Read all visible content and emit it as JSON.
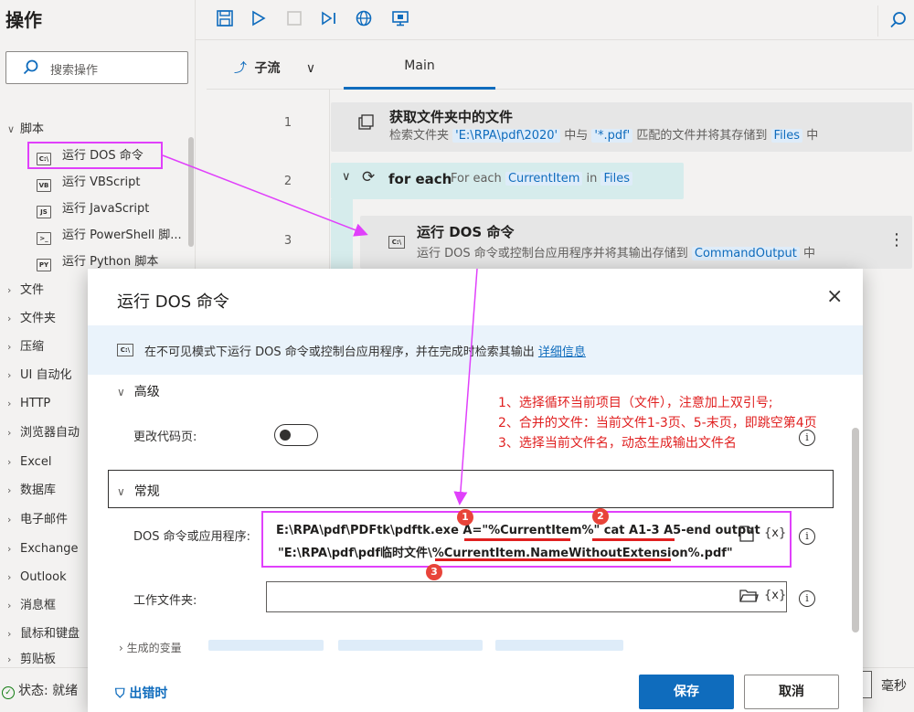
{
  "sidebar": {
    "title": "操作",
    "search_placeholder": "搜索操作",
    "scripts_group": "脚本",
    "script_items": [
      {
        "icon": "C:\\",
        "label": "运行 DOS 命令"
      },
      {
        "icon": "VB",
        "label": "运行 VBScript"
      },
      {
        "icon": "JS",
        "label": "运行 JavaScript"
      },
      {
        "icon": ">_",
        "label": "运行 PowerShell 脚..."
      },
      {
        "icon": "PY",
        "label": "运行 Python 脚本"
      }
    ],
    "groups": [
      "文件",
      "文件夹",
      "压缩",
      "UI 自动化",
      "HTTP",
      "浏览器自动",
      "Excel",
      "数据库",
      "电子邮件",
      "Exchange",
      "Outlook",
      "消息框",
      "鼠标和键盘",
      "剪贴板"
    ]
  },
  "status": {
    "text": "状态: 就绪",
    "unit": "毫秒"
  },
  "designer": {
    "subflow_label": "子流",
    "main_tab": "Main",
    "steps": [
      {
        "num": "1",
        "title": "获取文件夹中的文件",
        "desc_pre": "检索文件夹 ",
        "folder": "'E:\\RPA\\pdf\\2020'",
        "desc_mid": " 中与 ",
        "pattern": "'*.pdf'",
        "desc_mid2": " 匹配的文件并将其存储到 ",
        "var": "Files",
        "desc_end": " 中"
      },
      {
        "num": "2",
        "title": "for each",
        "desc_pre": "For each ",
        "var1": "CurrentItem",
        "desc_mid": " in ",
        "var2": "Files"
      },
      {
        "num": "3",
        "title": "运行 DOS 命令",
        "desc_pre": "运行 DOS 命令或控制台应用程序并将其输出存储到 ",
        "var": "CommandOutput",
        "desc_end": " 中"
      }
    ]
  },
  "dialog": {
    "title": "运行 DOS 命令",
    "info": "在不可见模式下运行 DOS 命令或控制台应用程序，并在完成时检索其输出",
    "info_link": "详细信息",
    "advanced_label": "高级",
    "codepage_label": "更改代码页:",
    "general_label": "常规",
    "cmd_label": "DOS 命令或应用程序:",
    "cmd_line1": "E:\\RPA\\pdf\\PDFtk\\pdftk.exe A=\"%CurrentItem%\" cat A1-3 A5-end output",
    "cmd_line2": "\"E:\\RPA\\pdf\\pdf临时文件\\%CurrentItem.NameWithoutExtension%.pdf\"",
    "workdir_label": "工作文件夹:",
    "gen_vars_label": "生成的变量",
    "fx": "{x}",
    "on_error": "出错时",
    "save": "保存",
    "cancel": "取消"
  },
  "annotations": {
    "notes": [
      "1、选择循环当前项目（文件），注意加上双引号;",
      "2、合并的文件：当前文件1-3页、5-末页，即跳空第4页",
      "3、选择当前文件名，动态生成输出文件名"
    ],
    "badges": [
      "1",
      "2",
      "3"
    ]
  }
}
